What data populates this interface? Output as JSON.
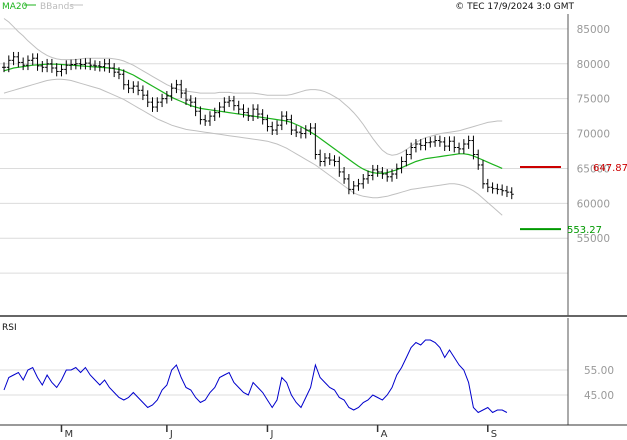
{
  "header": {
    "legend_ma": "MA20",
    "legend_bb": "BBands",
    "copyright": "© TEC 17/9/2024 3:0 GMT"
  },
  "colors": {
    "ma": "#1db31d",
    "bands": "#c0c0c0",
    "price": "#000000",
    "rsi": "#0000cc",
    "resistance": "#cc0000",
    "support": "#009900",
    "grid": "#dcdcdc",
    "frame": "#333333"
  },
  "chart_data": [
    {
      "type": "line",
      "title": "",
      "xlabel": "",
      "ylabel": "",
      "ylim": [
        47000,
        88000
      ],
      "y_ticks": [
        {
          "label": "85000",
          "value": 85000
        },
        {
          "label": "80000",
          "value": 80000
        },
        {
          "label": "75000",
          "value": 75000
        },
        {
          "label": "70000",
          "value": 70000
        },
        {
          "label": "65000",
          "value": 65000
        },
        {
          "label": "60000",
          "value": 60000
        },
        {
          "label": "55000",
          "value": 55000
        }
      ],
      "x_ticks": [
        {
          "label": "M",
          "index": 12
        },
        {
          "label": "J",
          "index": 34
        },
        {
          "label": "J",
          "index": 55
        },
        {
          "label": "A",
          "index": 78
        },
        {
          "label": "S",
          "index": 101
        }
      ],
      "levels": [
        {
          "label": "647.87",
          "value": 65200,
          "color_key": "resistance"
        },
        {
          "label": "553.27",
          "value": 56300,
          "color_key": "support"
        }
      ],
      "series": [
        {
          "name": "MA20",
          "values": [
            79000,
            79200,
            79400,
            79500,
            79600,
            79700,
            79800,
            79850,
            79900,
            79950,
            79950,
            79950,
            79900,
            79850,
            79800,
            79750,
            79700,
            79650,
            79600,
            79550,
            79500,
            79450,
            79400,
            79300,
            79200,
            79000,
            78700,
            78400,
            78000,
            77600,
            77200,
            76800,
            76400,
            76000,
            75600,
            75200,
            74900,
            74600,
            74300,
            74000,
            73800,
            73600,
            73500,
            73400,
            73300,
            73200,
            73100,
            73000,
            72900,
            72800,
            72700,
            72600,
            72500,
            72400,
            72300,
            72200,
            72100,
            72000,
            71900,
            71800,
            71600,
            71300,
            71000,
            70600,
            70200,
            69800,
            69300,
            68800,
            68300,
            67800,
            67300,
            66800,
            66300,
            65800,
            65300,
            64900,
            64600,
            64400,
            64300,
            64300,
            64400,
            64600,
            64800,
            65100,
            65400,
            65700,
            66000,
            66200,
            66400,
            66500,
            66600,
            66700,
            66800,
            66900,
            67000,
            67100,
            67100,
            67000,
            66800,
            66500,
            66200,
            65900,
            65600,
            65300,
            65000
          ]
        },
        {
          "name": "Upper Band",
          "values": [
            86500,
            86000,
            85300,
            84600,
            84000,
            83300,
            82700,
            82100,
            81600,
            81200,
            80900,
            80700,
            80600,
            80600,
            80600,
            80600,
            80700,
            80800,
            80800,
            80800,
            80800,
            80800,
            80800,
            80700,
            80600,
            80400,
            80100,
            79800,
            79400,
            79000,
            78600,
            78200,
            77800,
            77400,
            77000,
            76700,
            76400,
            76200,
            76100,
            76000,
            75900,
            75800,
            75800,
            75800,
            75800,
            75900,
            75900,
            75900,
            75800,
            75800,
            75800,
            75800,
            75800,
            75700,
            75600,
            75500,
            75500,
            75500,
            75500,
            75500,
            75600,
            75800,
            76000,
            76200,
            76300,
            76300,
            76200,
            76000,
            75700,
            75300,
            74900,
            74300,
            73700,
            73000,
            72200,
            71300,
            70300,
            69300,
            68400,
            67600,
            67100,
            66900,
            67000,
            67300,
            67700,
            68200,
            68700,
            69100,
            69400,
            69600,
            69800,
            70000,
            70100,
            70200,
            70300,
            70400,
            70600,
            70800,
            71000,
            71200,
            71400,
            71600,
            71700,
            71800,
            71800
          ]
        },
        {
          "name": "Lower Band",
          "values": [
            75800,
            76000,
            76200,
            76400,
            76600,
            76800,
            77000,
            77200,
            77400,
            77600,
            77700,
            77800,
            77800,
            77700,
            77600,
            77400,
            77200,
            77000,
            76800,
            76600,
            76400,
            76100,
            75800,
            75500,
            75200,
            74900,
            74500,
            74100,
            73700,
            73300,
            72900,
            72500,
            72100,
            71800,
            71500,
            71200,
            71000,
            70800,
            70600,
            70500,
            70400,
            70300,
            70200,
            70100,
            70000,
            69900,
            69800,
            69700,
            69600,
            69500,
            69400,
            69300,
            69200,
            69100,
            69000,
            68900,
            68700,
            68500,
            68200,
            67900,
            67500,
            67100,
            66700,
            66300,
            65900,
            65500,
            65000,
            64500,
            64000,
            63500,
            63000,
            62500,
            62000,
            61500,
            61200,
            61000,
            60900,
            60800,
            60800,
            60900,
            61000,
            61200,
            61400,
            61600,
            61800,
            62000,
            62100,
            62200,
            62300,
            62400,
            62500,
            62600,
            62700,
            62800,
            62800,
            62700,
            62500,
            62200,
            61800,
            61300,
            60700,
            60100,
            59500,
            58900,
            58300
          ]
        },
        {
          "name": "Price",
          "values": [
            79500,
            80500,
            81000,
            80200,
            79800,
            80500,
            80800,
            79700,
            79500,
            80000,
            79400,
            78900,
            79200,
            79800,
            79900,
            80000,
            79900,
            80100,
            79800,
            79700,
            79600,
            80000,
            79400,
            78800,
            78500,
            77000,
            76500,
            76800,
            76200,
            75500,
            74500,
            73800,
            74500,
            75000,
            75400,
            76500,
            77000,
            75800,
            74800,
            74500,
            73200,
            72000,
            71800,
            72500,
            73000,
            73800,
            74500,
            74700,
            74000,
            73500,
            73000,
            72500,
            73500,
            72800,
            72000,
            71000,
            70500,
            71200,
            72500,
            72000,
            70500,
            70200,
            70000,
            70500,
            70800,
            67000,
            66000,
            66500,
            66200,
            66000,
            64500,
            63500,
            62000,
            62500,
            62800,
            63500,
            64000,
            64800,
            64500,
            64200,
            63800,
            64200,
            65000,
            66000,
            67000,
            68000,
            68500,
            68300,
            68700,
            68800,
            69000,
            68800,
            68200,
            68900,
            68000,
            67800,
            68500,
            69000,
            67000,
            65500,
            62800,
            62300,
            62100,
            62000,
            61800,
            61600,
            61300
          ]
        }
      ]
    },
    {
      "type": "line",
      "title": "",
      "ylabel": "RSI",
      "ylim": [
        35,
        75
      ],
      "y_ticks": [
        {
          "label": "55.00",
          "value": 55
        },
        {
          "label": "45.00",
          "value": 45
        }
      ],
      "series": [
        {
          "name": "RSI",
          "values": [
            47,
            52,
            53,
            54,
            51,
            55,
            56,
            52,
            49,
            53,
            50,
            48,
            51,
            55,
            55,
            56,
            54,
            56,
            53,
            51,
            49,
            51,
            48,
            46,
            44,
            43,
            44,
            46,
            44,
            42,
            40,
            41,
            43,
            47,
            49,
            55,
            57,
            52,
            48,
            47,
            44,
            42,
            43,
            46,
            48,
            52,
            53,
            54,
            50,
            48,
            46,
            45,
            50,
            48,
            46,
            43,
            40,
            43,
            52,
            50,
            45,
            42,
            40,
            44,
            48,
            57,
            52,
            50,
            48,
            47,
            44,
            43,
            40,
            39,
            40,
            42,
            43,
            45,
            44,
            43,
            45,
            48,
            53,
            56,
            60,
            64,
            66,
            65,
            67,
            67,
            66,
            64,
            60,
            63,
            60,
            57,
            55,
            50,
            40,
            38,
            39,
            40,
            38,
            39,
            39,
            38
          ]
        }
      ]
    }
  ]
}
